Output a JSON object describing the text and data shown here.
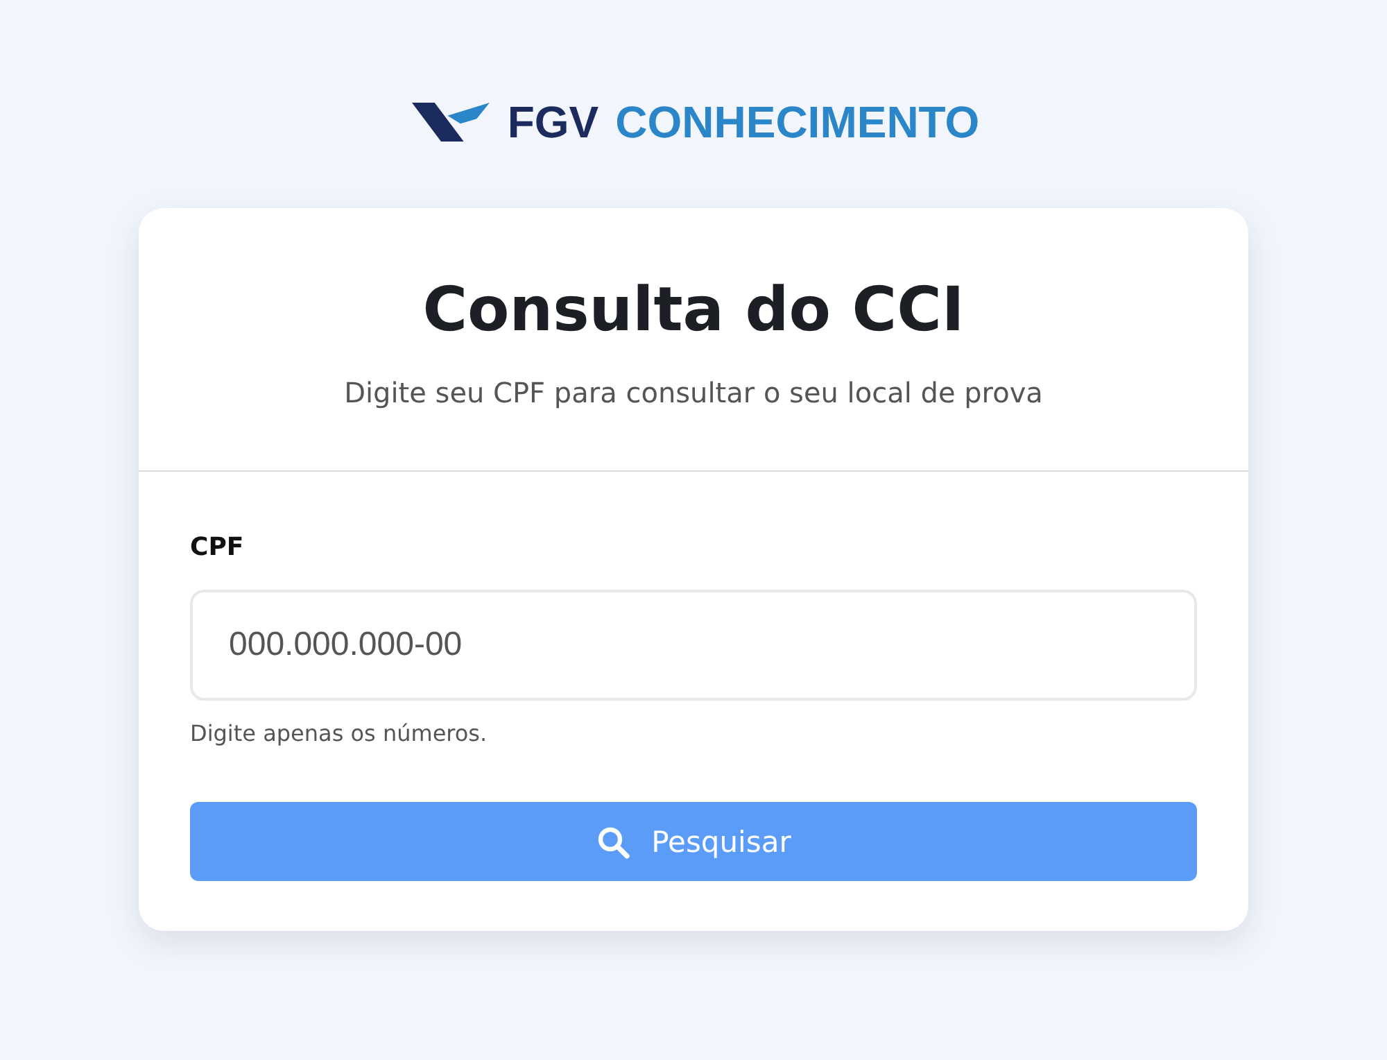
{
  "logo": {
    "brand": "FGV",
    "product": "CONHECIMENTO"
  },
  "card": {
    "title": "Consulta do CCI",
    "subtitle": "Digite seu CPF para consultar o seu local de prova"
  },
  "form": {
    "label": "CPF",
    "placeholder": "000.000.000-00",
    "hint": "Digite apenas os números.",
    "button": "Pesquisar"
  }
}
